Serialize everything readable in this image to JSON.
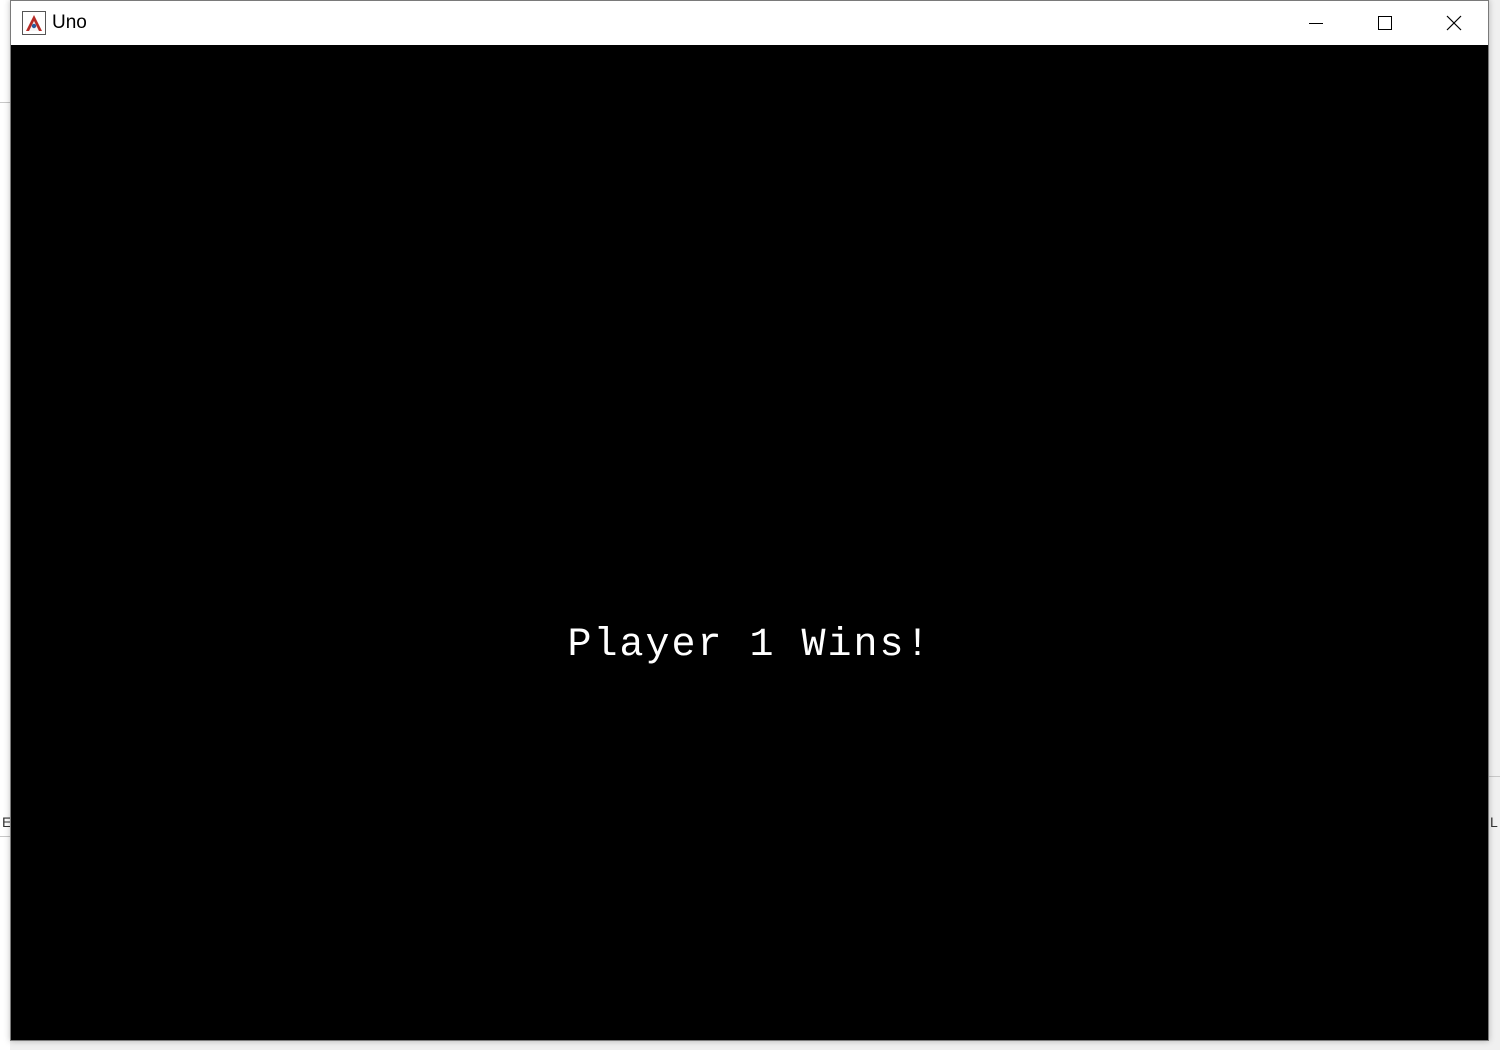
{
  "window": {
    "title": "Uno",
    "controls": {
      "minimize": "minimize-icon",
      "maximize": "maximize-icon",
      "close": "close-icon"
    }
  },
  "game": {
    "message": "Player 1 Wins!",
    "background_color": "#000000",
    "text_color": "#ffffff"
  },
  "background": {
    "left_fragment": "E",
    "right_fragment": "L"
  }
}
